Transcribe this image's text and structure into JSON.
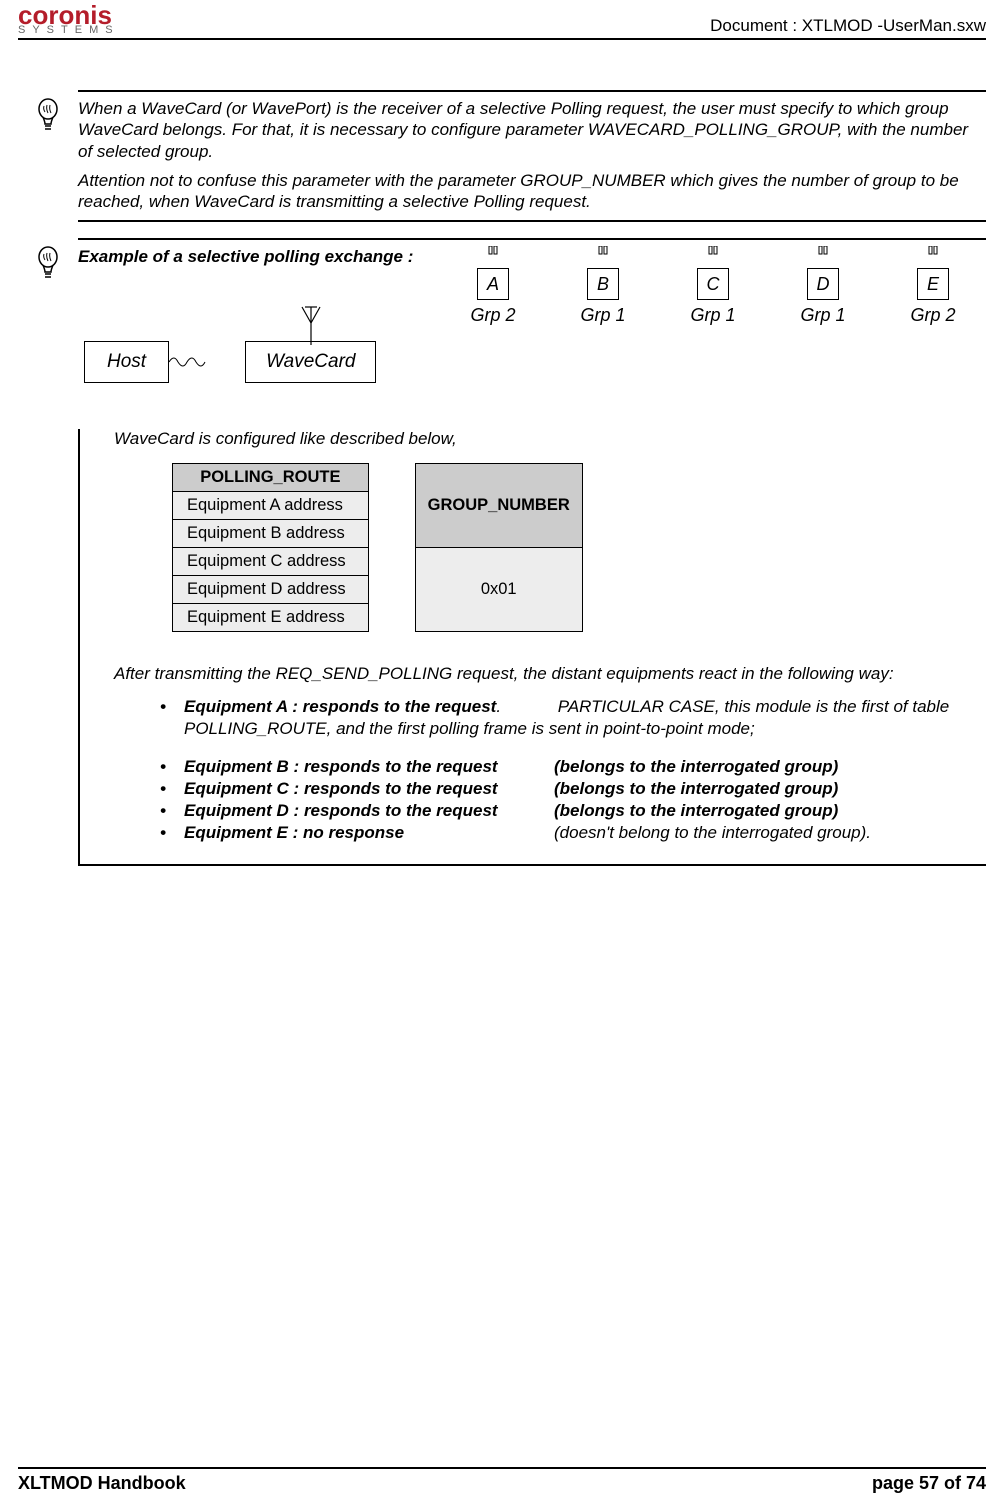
{
  "header": {
    "brand": "coronis",
    "brand_sub": "SYSTEMS",
    "doc": "Document : XTLMOD -UserMan.sxw"
  },
  "note1": {
    "p1": "When a WaveCard (or WavePort) is the receiver of a selective Polling request, the user must specify to which group WaveCard belongs. For that, it is necessary to configure parameter WAVECARD_POLLING_GROUP, with the number of selected group.",
    "p2": "Attention not to confuse this parameter with the parameter GROUP_NUMBER which gives the number of group to be reached, when WaveCard is transmitting a selective Polling request."
  },
  "example": {
    "title": "Example of a selective polling exchange :",
    "host": "Host",
    "wavecard": "WaveCard",
    "devices": [
      {
        "label": "A",
        "grp": "Grp 2"
      },
      {
        "label": "B",
        "grp": "Grp 1"
      },
      {
        "label": "C",
        "grp": "Grp 1"
      },
      {
        "label": "D",
        "grp": "Grp 1"
      },
      {
        "label": "E",
        "grp": "Grp 2"
      }
    ],
    "config_intro": "WaveCard is configured like described below,",
    "polling_route": {
      "header": "POLLING_ROUTE",
      "rows": [
        "Equipment  A address",
        "Equipment  B address",
        "Equipment  C address",
        "Equipment  D address",
        "Equipment  E address"
      ]
    },
    "group_number": {
      "header": "GROUP_NUMBER",
      "value": "0x01"
    },
    "after": "After transmitting the REQ_SEND_POLLING request, the distant equipments react in the following way:",
    "respA": {
      "lead": "Equipment A : responds to the request",
      "note": "PARTICULAR CASE, this module is the first of table POLLING_ROUTE, and the first polling frame is sent in point-to-point mode;"
    },
    "responses": [
      {
        "lead": "Equipment B : responds to the request",
        "tail": "(belongs to the interrogated group)"
      },
      {
        "lead": "Equipment C : responds to the request",
        "tail": "(belongs to the interrogated group)"
      },
      {
        "lead": "Equipment D : responds to the request",
        "tail": "(belongs to the interrogated group)"
      },
      {
        "lead": "Equipment E : no response",
        "tail": "(doesn't belong to the interrogated group)."
      }
    ]
  },
  "footer": {
    "left": "XLTMOD Handbook",
    "right": "page 57 of 74"
  }
}
